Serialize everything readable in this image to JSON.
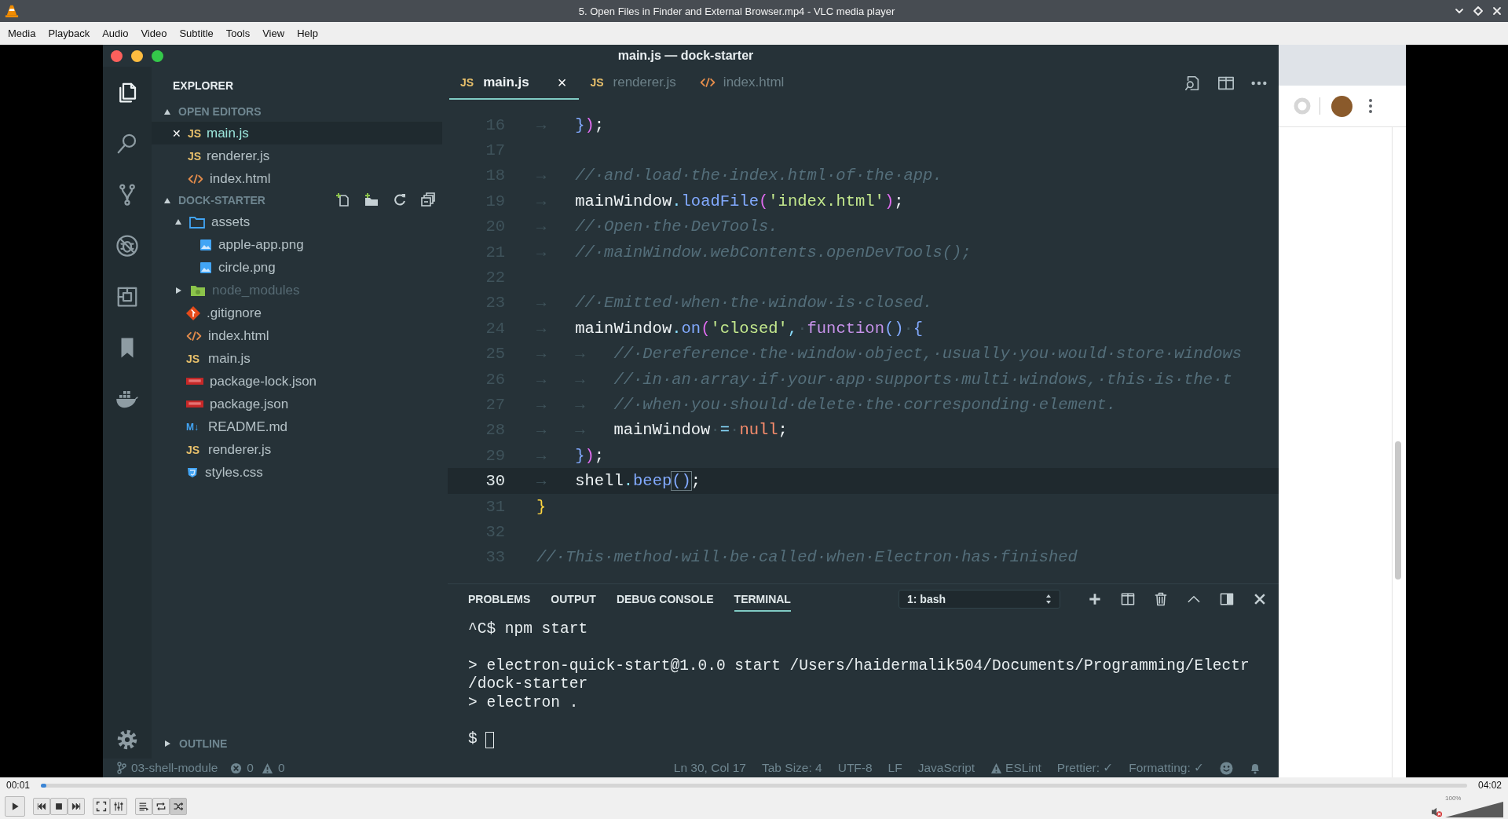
{
  "player": {
    "title": "5. Open Files in Finder and External Browser.mp4 - VLC media player",
    "menu": [
      "Media",
      "Playback",
      "Audio",
      "Video",
      "Subtitle",
      "Tools",
      "View",
      "Help"
    ]
  },
  "vscode": {
    "title": "main.js — dock-starter",
    "activity_bar": [
      {
        "kind": "files",
        "selected": true
      },
      {
        "kind": "search",
        "selected": false
      },
      {
        "kind": "scm",
        "selected": false
      },
      {
        "kind": "debug",
        "selected": false
      },
      {
        "kind": "extensions",
        "selected": false
      },
      {
        "kind": "bookmark",
        "selected": false
      },
      {
        "kind": "docker",
        "selected": false
      }
    ],
    "sidebar": {
      "title": "EXPLORER",
      "open_editors": {
        "title": "OPEN EDITORS",
        "expanded": true,
        "items": [
          {
            "name": "main.js",
            "kind": "js",
            "icon_label": "JS",
            "close": "✕",
            "selected": true
          },
          {
            "name": "renderer.js",
            "kind": "js",
            "icon_label": "JS",
            "selected": false
          },
          {
            "name": "index.html",
            "kind": "html",
            "selected": false
          }
        ]
      },
      "project": {
        "title": "DOCK-STARTER",
        "expanded": true,
        "tree": [
          {
            "name": "assets",
            "kind": "folder",
            "expanded": true,
            "dimmed": false,
            "children": [
              {
                "name": "apple-app.png",
                "kind": "image",
                "dimmed": false
              },
              {
                "name": "circle.png",
                "kind": "image",
                "dimmed": false
              }
            ]
          },
          {
            "name": "node_modules",
            "kind": "folder",
            "expanded": false,
            "dimmed": true
          },
          {
            "name": ".gitignore",
            "kind": "git",
            "dimmed": false
          },
          {
            "name": "index.html",
            "kind": "html",
            "dimmed": false
          },
          {
            "name": "main.js",
            "kind": "js",
            "icon_label": "JS",
            "dimmed": false
          },
          {
            "name": "package-lock.json",
            "kind": "npm",
            "dimmed": false
          },
          {
            "name": "package.json",
            "kind": "npm",
            "dimmed": false
          },
          {
            "name": "README.md",
            "kind": "markdown",
            "icon_label": "M↓",
            "dimmed": false
          },
          {
            "name": "renderer.js",
            "kind": "js",
            "icon_label": "JS",
            "dimmed": false
          },
          {
            "name": "styles.css",
            "kind": "css",
            "dimmed": false
          }
        ]
      },
      "outline": {
        "title": "OUTLINE",
        "expanded": false
      }
    },
    "tabs": [
      {
        "name": "main.js",
        "kind": "js",
        "icon_label": "JS",
        "close": "×",
        "selected": true
      },
      {
        "name": "renderer.js",
        "kind": "js",
        "icon_label": "JS",
        "selected": false
      },
      {
        "name": "index.html",
        "kind": "html",
        "selected": false
      }
    ],
    "code": [
      {
        "number": "16",
        "current": false,
        "tokens": [
          {
            "kind": "tab",
            "text": "→"
          },
          {
            "kind": "bracket1",
            "text": "}"
          },
          {
            "kind": "bracket2",
            "text": ")"
          },
          {
            "kind": "plain",
            "text": ";"
          }
        ]
      },
      {
        "number": "17",
        "current": false
      },
      {
        "number": "18",
        "current": false,
        "tokens": [
          {
            "kind": "tab",
            "text": "→"
          },
          {
            "kind": "comment",
            "text": "//·and·load·the·index.html·of·the·app."
          }
        ]
      },
      {
        "number": "19",
        "current": false,
        "tokens": [
          {
            "kind": "tab",
            "text": "→"
          },
          {
            "kind": "plain",
            "text": "mainWindow"
          },
          {
            "kind": "punct",
            "text": "."
          },
          {
            "kind": "method",
            "text": "loadFile"
          },
          {
            "kind": "bracket2",
            "text": "("
          },
          {
            "kind": "string",
            "text": "'index.html'"
          },
          {
            "kind": "bracket2",
            "text": ")"
          },
          {
            "kind": "plain",
            "text": ";"
          }
        ]
      },
      {
        "number": "20",
        "current": false,
        "tokens": [
          {
            "kind": "tab",
            "text": "→"
          },
          {
            "kind": "comment",
            "text": "//·Open·the·DevTools."
          }
        ]
      },
      {
        "number": "21",
        "current": false,
        "tokens": [
          {
            "kind": "tab",
            "text": "→"
          },
          {
            "kind": "comment",
            "text": "//·mainWindow.webContents.openDevTools();"
          }
        ]
      },
      {
        "number": "22",
        "current": false
      },
      {
        "number": "23",
        "current": false,
        "tokens": [
          {
            "kind": "tab",
            "text": "→"
          },
          {
            "kind": "comment",
            "text": "//·Emitted·when·the·window·is·closed."
          }
        ]
      },
      {
        "number": "24",
        "current": false,
        "tokens": [
          {
            "kind": "tab",
            "text": "→"
          },
          {
            "kind": "plain",
            "text": "mainWindow"
          },
          {
            "kind": "punct",
            "text": "."
          },
          {
            "kind": "method",
            "text": "on"
          },
          {
            "kind": "bracket2",
            "text": "("
          },
          {
            "kind": "string",
            "text": "'closed'"
          },
          {
            "kind": "punct",
            "text": ","
          },
          {
            "kind": "space",
            "text": "·"
          },
          {
            "kind": "keyword",
            "text": "function"
          },
          {
            "kind": "bracket1",
            "text": "()"
          },
          {
            "kind": "space",
            "text": "·"
          },
          {
            "kind": "bracket1",
            "text": "{"
          }
        ]
      },
      {
        "number": "25",
        "current": false,
        "tokens": [
          {
            "kind": "tab",
            "text": "→"
          },
          {
            "kind": "tab",
            "text": "→"
          },
          {
            "kind": "comment",
            "text": "//·Dereference·the·window·object,·usually·you·would·store·windows"
          }
        ]
      },
      {
        "number": "26",
        "current": false,
        "tokens": [
          {
            "kind": "tab",
            "text": "→"
          },
          {
            "kind": "tab",
            "text": "→"
          },
          {
            "kind": "comment",
            "text": "//·in·an·array·if·your·app·supports·multi·windows,·this·is·the·t"
          }
        ]
      },
      {
        "number": "27",
        "current": false,
        "tokens": [
          {
            "kind": "tab",
            "text": "→"
          },
          {
            "kind": "tab",
            "text": "→"
          },
          {
            "kind": "comment",
            "text": "//·when·you·should·delete·the·corresponding·element."
          }
        ]
      },
      {
        "number": "28",
        "current": false,
        "tokens": [
          {
            "kind": "tab",
            "text": "→"
          },
          {
            "kind": "tab",
            "text": "→"
          },
          {
            "kind": "plain",
            "text": "mainWindow"
          },
          {
            "kind": "space",
            "text": "·"
          },
          {
            "kind": "operator",
            "text": "="
          },
          {
            "kind": "space",
            "text": "·"
          },
          {
            "kind": "literal",
            "text": "null"
          },
          {
            "kind": "plain",
            "text": ";"
          }
        ]
      },
      {
        "number": "29",
        "current": false,
        "tokens": [
          {
            "kind": "tab",
            "text": "→"
          },
          {
            "kind": "bracket1",
            "text": "}"
          },
          {
            "kind": "bracket2",
            "text": ")"
          },
          {
            "kind": "plain",
            "text": ";"
          }
        ]
      },
      {
        "number": "30",
        "current": true,
        "tokens": [
          {
            "kind": "tab",
            "text": "→"
          },
          {
            "kind": "plain",
            "text": "shell"
          },
          {
            "kind": "punct",
            "text": "."
          },
          {
            "kind": "method",
            "text": "beep"
          },
          {
            "kind": "matched",
            "text": "()"
          },
          {
            "kind": "plain",
            "text": ";"
          }
        ]
      },
      {
        "number": "31",
        "current": false,
        "tokens": [
          {
            "kind": "bracket3",
            "text": "}"
          }
        ]
      },
      {
        "number": "32",
        "current": false
      },
      {
        "number": "33",
        "current": false,
        "tokens": [
          {
            "kind": "comment",
            "text": "//·This·method·will·be·called·when·Electron·has·finished"
          }
        ]
      }
    ],
    "panel": {
      "tabs": [
        {
          "label": "PROBLEMS",
          "selected": false
        },
        {
          "label": "OUTPUT",
          "selected": false
        },
        {
          "label": "DEBUG CONSOLE",
          "selected": false
        },
        {
          "label": "TERMINAL",
          "selected": true
        }
      ],
      "terminal_select": "1: bash",
      "terminal_blocks": [
        [
          "^C$ npm start"
        ],
        [
          "> electron-quick-start@1.0.0 start /Users/haidermalik504/Documents/Programming/Electr",
          "/dock-starter",
          "> electron ."
        ]
      ],
      "prompt": "$"
    },
    "status_bar": {
      "branch": "03-shell-module",
      "errors": "0",
      "warnings": "0",
      "items": [
        "Ln 30, Col 17",
        "Tab Size: 4",
        "UTF-8",
        "LF",
        "JavaScript"
      ],
      "eslint": "ESLint",
      "prettier": "Prettier: ✓",
      "formatting": "Formatting: ✓"
    }
  },
  "controls": {
    "elapsed": "00:01",
    "duration": "04:02",
    "level": 0.004,
    "buttons": [
      {
        "kind": "play",
        "pressed": false
      },
      {
        "kind": "previous",
        "pressed": false
      },
      {
        "kind": "stop",
        "pressed": false
      },
      {
        "kind": "next",
        "pressed": false
      },
      {
        "kind": "fullscreen",
        "pressed": false
      },
      {
        "kind": "extended",
        "pressed": false
      },
      {
        "kind": "playlist",
        "pressed": false
      },
      {
        "kind": "loop",
        "pressed": false
      },
      {
        "kind": "shuffle",
        "pressed": true
      }
    ],
    "volume": {
      "muted": true,
      "level": 1.0,
      "reading": "100%"
    }
  }
}
